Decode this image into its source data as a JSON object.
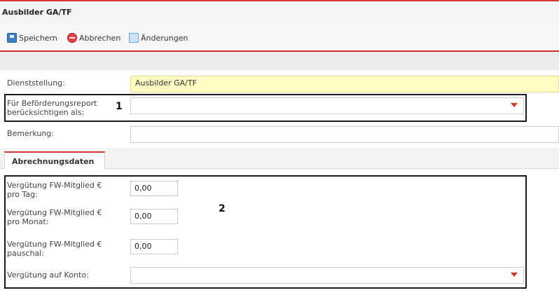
{
  "window": {
    "title": "Ausbilder GA/TF"
  },
  "toolbar": {
    "save_label": "Speichern",
    "cancel_label": "Abbrechen",
    "changes_label": "Änderungen"
  },
  "form": {
    "dienststellung": {
      "label": "Dienststellung:",
      "value": "Ausbilder GA/TF"
    },
    "befoerderung": {
      "label_line1": "Für Beförderungsreport",
      "label_line2": "berücksichtigen als:",
      "value": "",
      "marker": "1"
    },
    "bemerkung": {
      "label": "Bemerkung:",
      "value": ""
    }
  },
  "tabs": [
    {
      "label": "Abrechnungsdaten"
    }
  ],
  "abrechnung": {
    "marker": "2",
    "pro_tag": {
      "label_line1": "Vergütung FW-Mitglied €",
      "label_line2": "pro Tag:",
      "value": "0,00"
    },
    "pro_monat": {
      "label_line1": "Vergütung FW-Mitglied €",
      "label_line2": "pro Monat:",
      "value": "0,00"
    },
    "pauschal": {
      "label_line1": "Vergütung FW-Mitglied €",
      "label_line2": "pauschal:",
      "value": "0,00"
    },
    "konto": {
      "label": "Vergütung auf Konto:",
      "value": ""
    }
  },
  "colors": {
    "accent": "#d33333",
    "highlight_field": "#fffdc4",
    "dropdown_arrow": "#d9302b"
  }
}
